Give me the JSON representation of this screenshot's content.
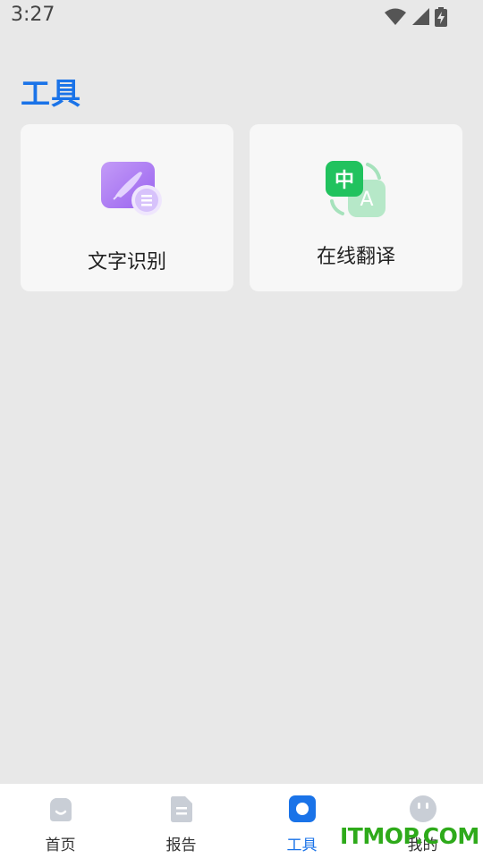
{
  "status_bar": {
    "time": "3:27",
    "icons": [
      "wifi-icon",
      "signal-icon",
      "battery-charging-icon"
    ]
  },
  "page": {
    "title": "工具"
  },
  "tools": [
    {
      "label": "文字识别",
      "icon": "text-recognition-icon",
      "accent": "#a874f5"
    },
    {
      "label": "在线翻译",
      "icon": "translate-icon",
      "accent": "#21c25e"
    }
  ],
  "bottom_nav": {
    "items": [
      {
        "label": "首页",
        "icon": "home-icon"
      },
      {
        "label": "报告",
        "icon": "report-icon"
      },
      {
        "label": "工具",
        "icon": "tools-icon",
        "active": true
      },
      {
        "label": "我的",
        "icon": "profile-icon"
      }
    ]
  },
  "watermark": "ITMOP.COM",
  "colors": {
    "accent": "#1a73e8",
    "background": "#e8e8e8",
    "card": "#f7f7f7",
    "inactive_icon": "#c9ced6"
  }
}
